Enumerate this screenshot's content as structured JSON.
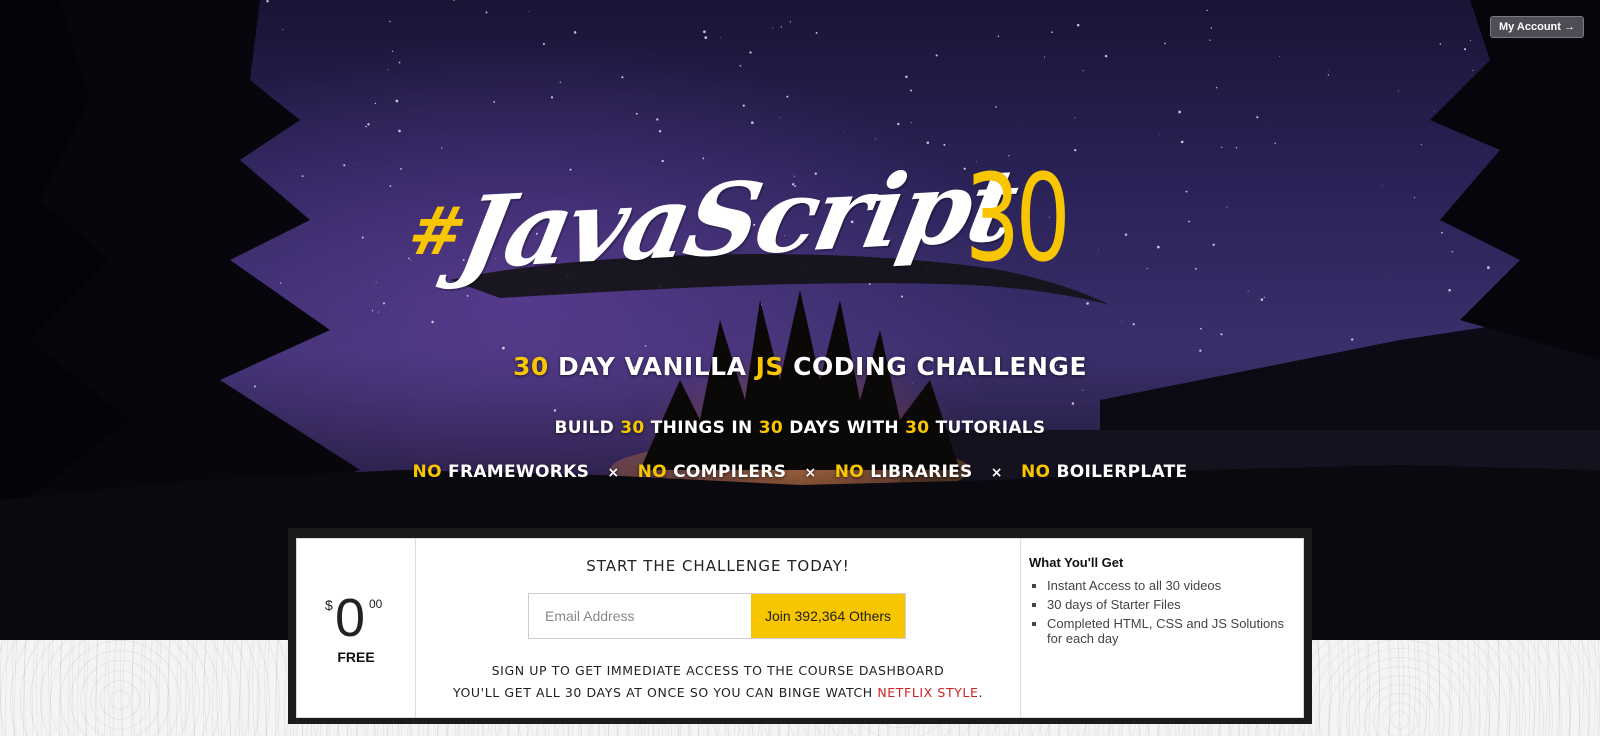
{
  "header": {
    "account_label": "My Account",
    "account_arrow": "→"
  },
  "logo": {
    "hash": "#",
    "word": "JavaScript",
    "number": "30"
  },
  "tagline1": {
    "num": "30",
    "a": " DAY VANILLA ",
    "js": "JS",
    "b": " CODING CHALLENGE"
  },
  "tagline2": {
    "a": "BUILD ",
    "n1": "30",
    "b": " THINGS IN ",
    "n2": "30",
    "c": " DAYS WITH ",
    "n3": "30",
    "d": " TUTORIALS"
  },
  "tagline3": {
    "items": [
      {
        "no": "NO",
        "text": " FRAMEWORKS"
      },
      {
        "no": "NO",
        "text": " COMPILERS"
      },
      {
        "no": "NO",
        "text": " LIBRARIES"
      },
      {
        "no": "NO",
        "text": " BOILERPLATE"
      }
    ],
    "separator": "×"
  },
  "price": {
    "currency": "$",
    "amount": "0",
    "cents": "00",
    "label": "FREE"
  },
  "signup": {
    "title": "START THE CHALLENGE TODAY!",
    "email_placeholder": "Email Address",
    "join_label": "Join 392,364 Others",
    "line1": "SIGN UP TO GET IMMEDIATE ACCESS TO THE COURSE DASHBOARD",
    "line2_a": "YOU'LL GET ALL 30 DAYS AT ONCE SO YOU CAN BINGE WATCH ",
    "line2_link": "NETFLIX STYLE",
    "line2_end": "."
  },
  "benefits": {
    "title": "What You'll Get",
    "items": [
      "Instant Access to all 30 videos",
      "30 days of Starter Files",
      "Completed HTML, CSS and JS Solutions for each day"
    ]
  },
  "colors": {
    "accent": "#f7c600",
    "link": "#d21f1f"
  }
}
